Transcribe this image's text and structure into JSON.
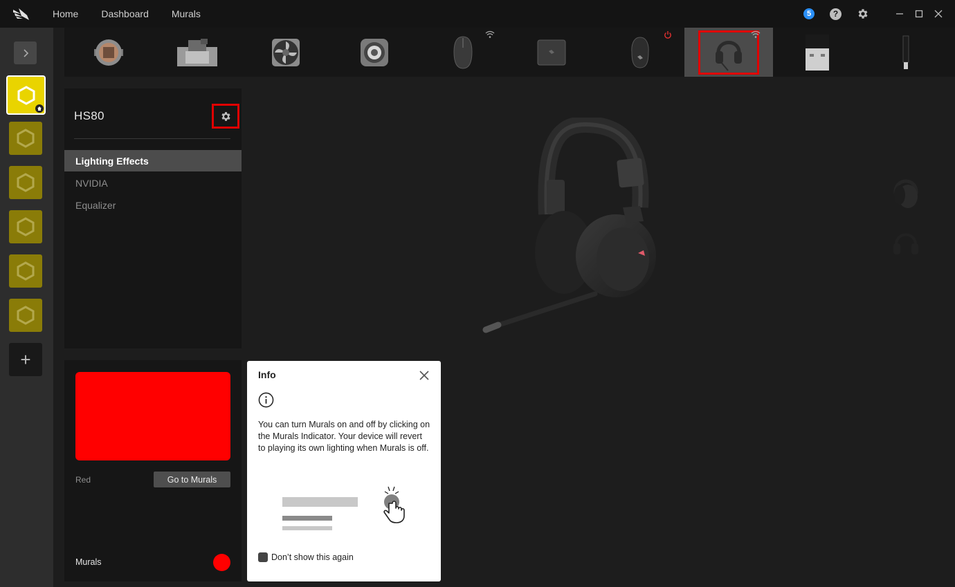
{
  "topbar": {
    "nav": [
      "Home",
      "Dashboard",
      "Murals"
    ],
    "notifications_count": "5",
    "help_icon": "?",
    "icons": [
      "corsair-logo-icon",
      "notification-badge",
      "help-icon",
      "gear-icon",
      "minimize-icon",
      "maximize-icon",
      "close-icon"
    ]
  },
  "sidebar": {
    "profiles_count": 6,
    "active_profile_index": 0,
    "add_label": "+"
  },
  "devices": [
    {
      "name": "cpu-cooler-device",
      "wireless": false
    },
    {
      "name": "gpu-block-device",
      "wireless": false
    },
    {
      "name": "fan-device",
      "wireless": false
    },
    {
      "name": "pump-device",
      "wireless": false
    },
    {
      "name": "wireless-mouse-device",
      "wireless": true
    },
    {
      "name": "controller-device",
      "wireless": false
    },
    {
      "name": "gaming-mouse-device",
      "status": "power-off"
    },
    {
      "name": "headset-device",
      "wireless": true,
      "selected": true
    },
    {
      "name": "usb-dongle-device",
      "wireless": false
    },
    {
      "name": "usb-stick-device",
      "wireless": false
    }
  ],
  "device_panel": {
    "title": "HS80",
    "menu": [
      "Lighting Effects",
      "NVIDIA",
      "Equalizer"
    ],
    "active_menu_index": 0
  },
  "murals_panel": {
    "color_name": "Red",
    "color_hex": "#ff0000",
    "goto_label": "Go to Murals",
    "murals_label": "Murals",
    "indicator_color": "#ff0000"
  },
  "info_popup": {
    "title": "Info",
    "text": "You can turn Murals on and off by clicking on the Murals Indicator. Your device will revert to playing its own lighting when Murals is off.",
    "dont_show_label": "Don’t show this again"
  },
  "colors": {
    "accent_yellow": "#e9d400",
    "highlight_red": "#e00000"
  }
}
